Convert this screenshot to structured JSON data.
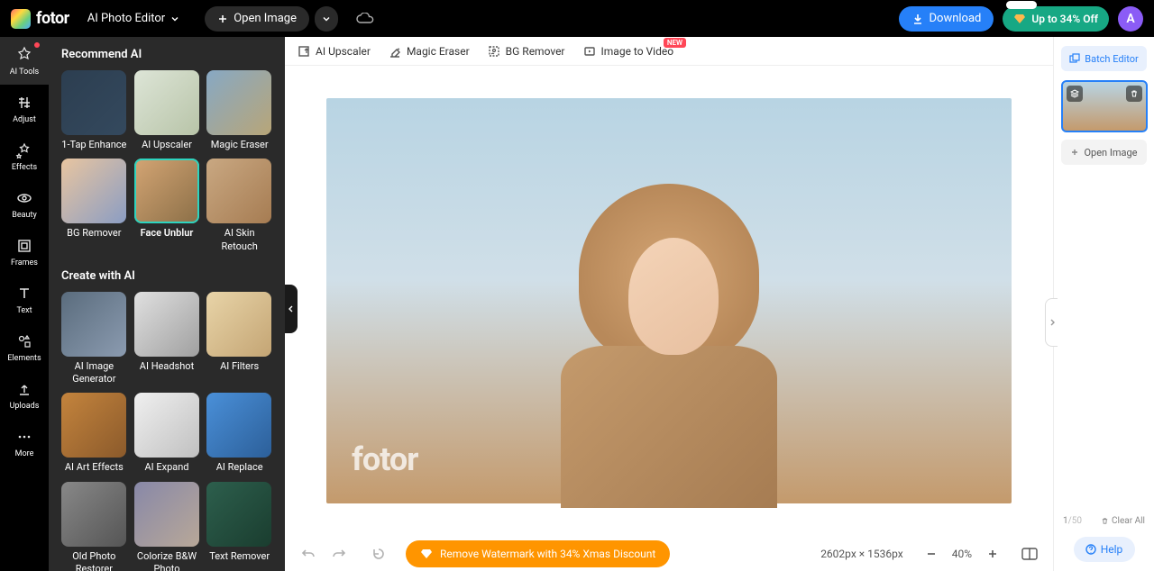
{
  "header": {
    "logo_text": "fotor",
    "editor_selector": "AI Photo Editor",
    "open_image": "Open Image",
    "download": "Download",
    "promo": "Up to 34% Off",
    "avatar_initial": "A"
  },
  "rail": [
    {
      "id": "ai-tools",
      "label": "AI Tools",
      "active": true,
      "dot": true
    },
    {
      "id": "adjust",
      "label": "Adjust"
    },
    {
      "id": "effects",
      "label": "Effects"
    },
    {
      "id": "beauty",
      "label": "Beauty"
    },
    {
      "id": "frames",
      "label": "Frames"
    },
    {
      "id": "text",
      "label": "Text"
    },
    {
      "id": "elements",
      "label": "Elements"
    },
    {
      "id": "uploads",
      "label": "Uploads"
    },
    {
      "id": "more",
      "label": "More"
    }
  ],
  "panel": {
    "section1_title": "Recommend AI",
    "section2_title": "Create with AI",
    "recommend": [
      {
        "label": "1-Tap Enhance",
        "thumb": "th-street"
      },
      {
        "label": "AI Upscaler",
        "thumb": "th-panda"
      },
      {
        "label": "Magic Eraser",
        "thumb": "th-house"
      },
      {
        "label": "BG Remover",
        "thumb": "th-woman1"
      },
      {
        "label": "Face Unblur",
        "thumb": "th-woman2",
        "selected": true
      },
      {
        "label": "AI Skin Retouch",
        "thumb": "th-woman3"
      }
    ],
    "create": [
      {
        "label": "AI Image Generator",
        "thumb": "th-astro"
      },
      {
        "label": "AI Headshot",
        "thumb": "th-suit"
      },
      {
        "label": "AI Filters",
        "thumb": "th-blonde"
      },
      {
        "label": "AI Art Effects",
        "thumb": "th-dogs"
      },
      {
        "label": "AI Expand",
        "thumb": "th-bw"
      },
      {
        "label": "AI Replace",
        "thumb": "th-ice"
      },
      {
        "label": "Old Photo Restorer",
        "thumb": "th-old"
      },
      {
        "label": "Colorize B&W Photo",
        "thumb": "th-colorize"
      },
      {
        "label": "Text Remover",
        "thumb": "th-cup"
      }
    ]
  },
  "toolbar": [
    {
      "id": "ai-upscaler",
      "label": "AI Upscaler"
    },
    {
      "id": "magic-eraser",
      "label": "Magic Eraser"
    },
    {
      "id": "bg-remover",
      "label": "BG Remover"
    },
    {
      "id": "image-to-video",
      "label": "Image to Video",
      "badge": "NEW"
    }
  ],
  "canvas": {
    "watermark": "fotor"
  },
  "bottom": {
    "promo_text": "Remove Watermark with 34% Xmas Discount",
    "dimensions": "2602px × 1536px",
    "zoom": "40%"
  },
  "right": {
    "batch": "Batch Editor",
    "open_image": "Open Image",
    "counter_current": "1",
    "counter_sep": "/",
    "counter_total": "50",
    "clear_all": "Clear All",
    "help": "Help"
  }
}
